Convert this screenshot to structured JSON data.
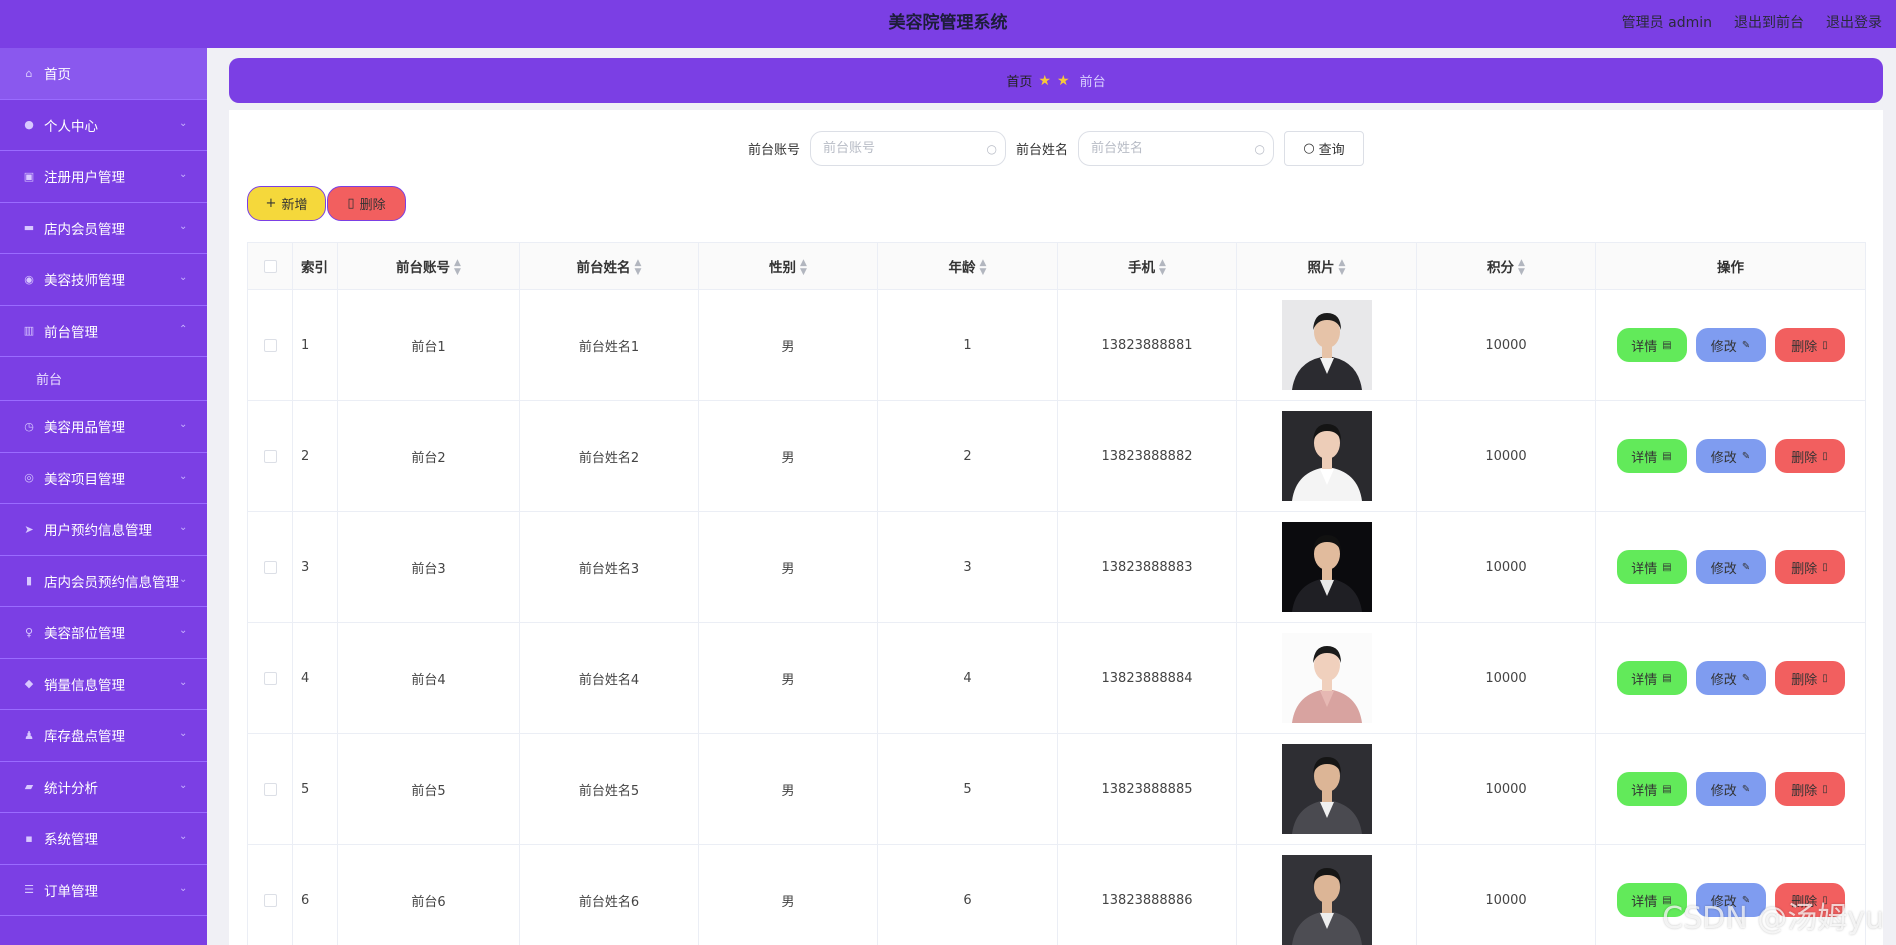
{
  "header": {
    "title": "美容院管理系统",
    "admin": "管理员 admin",
    "to_front": "退出到前台",
    "logout": "退出登录"
  },
  "sidebar": {
    "items": [
      {
        "label": "首页",
        "icon": "home-icon"
      },
      {
        "label": "个人中心",
        "icon": "user-icon"
      },
      {
        "label": "注册用户管理",
        "icon": "clipboard-icon"
      },
      {
        "label": "店内会员管理",
        "icon": "monitor-icon"
      },
      {
        "label": "美容技师管理",
        "icon": "compass-icon"
      },
      {
        "label": "前台管理",
        "icon": "bars-icon"
      },
      {
        "label": "美容用品管理",
        "icon": "clock-icon"
      },
      {
        "label": "美容项目管理",
        "icon": "circle-icon"
      },
      {
        "label": "用户预约信息管理",
        "icon": "send-icon"
      },
      {
        "label": "店内会员预约信息管理",
        "icon": "chart-icon"
      },
      {
        "label": "美容部位管理",
        "icon": "mic-icon"
      },
      {
        "label": "销量信息管理",
        "icon": "thumb-icon"
      },
      {
        "label": "库存盘点管理",
        "icon": "person-icon"
      },
      {
        "label": "统计分析",
        "icon": "film-icon"
      },
      {
        "label": "系统管理",
        "icon": "chat-icon"
      },
      {
        "label": "订单管理",
        "icon": "list-icon"
      }
    ],
    "submenu": {
      "label": "前台"
    }
  },
  "breadcrumb": {
    "home": "首页",
    "current": "前台"
  },
  "search": {
    "account_label": "前台账号",
    "account_placeholder": "前台账号",
    "name_label": "前台姓名",
    "name_placeholder": "前台姓名",
    "query_label": "查询"
  },
  "actions": {
    "add_label": "新增",
    "delete_label": "删除"
  },
  "table": {
    "headers": {
      "index": "索引",
      "account": "前台账号",
      "name": "前台姓名",
      "gender": "性别",
      "age": "年龄",
      "phone": "手机",
      "photo": "照片",
      "points": "积分",
      "ops": "操作"
    },
    "op_labels": {
      "detail": "详情",
      "edit": "修改",
      "remove": "删除"
    },
    "rows": [
      {
        "index": "1",
        "account": "前台1",
        "name": "前台姓名1",
        "gender": "男",
        "age": "1",
        "phone": "13823888881",
        "points": "10000"
      },
      {
        "index": "2",
        "account": "前台2",
        "name": "前台姓名2",
        "gender": "男",
        "age": "2",
        "phone": "13823888882",
        "points": "10000"
      },
      {
        "index": "3",
        "account": "前台3",
        "name": "前台姓名3",
        "gender": "男",
        "age": "3",
        "phone": "13823888883",
        "points": "10000"
      },
      {
        "index": "4",
        "account": "前台4",
        "name": "前台姓名4",
        "gender": "男",
        "age": "4",
        "phone": "13823888884",
        "points": "10000"
      },
      {
        "index": "5",
        "account": "前台5",
        "name": "前台姓名5",
        "gender": "男",
        "age": "5",
        "phone": "13823888885",
        "points": "10000"
      },
      {
        "index": "6",
        "account": "前台6",
        "name": "前台姓名6",
        "gender": "男",
        "age": "6",
        "phone": "13823888886",
        "points": "10000"
      }
    ]
  },
  "watermark": "CSDN @汤姆yu",
  "colors": {
    "brand": "#7b3fe4",
    "add_button": "#f5d83b",
    "delete_button": "#f25f5f",
    "detail_button": "#62ea5a",
    "edit_button": "#7f9cf0"
  }
}
